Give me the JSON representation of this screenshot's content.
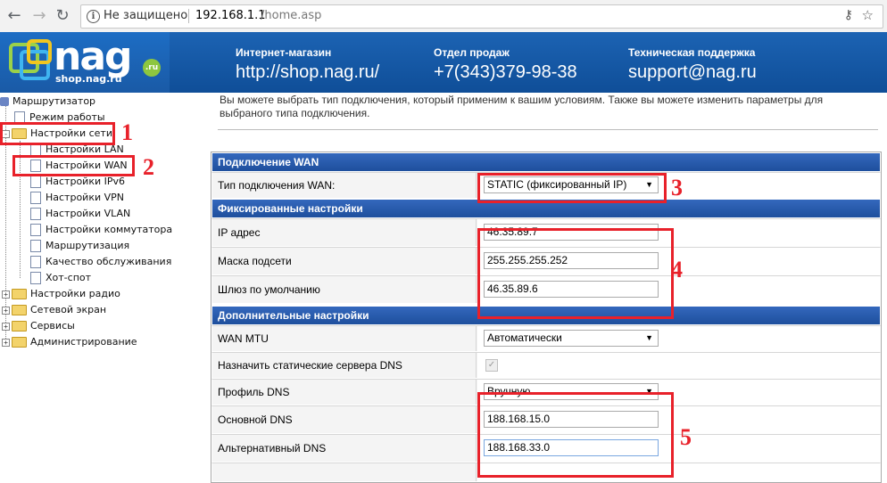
{
  "browser": {
    "back_icon": "arrow-left-icon",
    "forward_icon": "arrow-right-icon",
    "reload_icon": "reload-icon",
    "security_label": "Не защищено",
    "url_host": "192.168.1.1",
    "url_path": "/home.asp"
  },
  "banner": {
    "logo_text": "nag",
    "logo_badge": ".ru",
    "logo_site": "shop.nag.ru",
    "shop_label": "Интернет-магазин",
    "shop_value": "http://shop.nag.ru/",
    "sales_label": "Отдел продаж",
    "sales_value": "+7(343)379-98-38",
    "support_label": "Техническая поддержка",
    "support_value": "support@nag.ru"
  },
  "tree": {
    "root": "Маршрутизатор",
    "items": [
      {
        "label": "Режим работы"
      },
      {
        "label": "Настройки сети"
      },
      {
        "label": "Настройки LAN"
      },
      {
        "label": "Настройки WAN"
      },
      {
        "label": "Настройки IPv6"
      },
      {
        "label": "Настройки VPN"
      },
      {
        "label": "Настройки VLAN"
      },
      {
        "label": "Настройки коммутатора"
      },
      {
        "label": "Маршрутизация"
      },
      {
        "label": "Качество обслуживания"
      },
      {
        "label": "Хот-спот"
      },
      {
        "label": "Настройки радио"
      },
      {
        "label": "Сетевой экран"
      },
      {
        "label": "Сервисы"
      },
      {
        "label": "Администрирование"
      }
    ]
  },
  "annotations": [
    "1",
    "2",
    "3",
    "4",
    "5"
  ],
  "annotation_color": "#e8212a",
  "main": {
    "intro": "Вы можете выбрать тип подключения, который применим к вашим условиям. Также вы можете изменить параметры для выбраного типа подключения.",
    "sections": {
      "wan": {
        "title": "Подключение WAN",
        "type_label": "Тип подключения WAN:",
        "type_value": "STATIC (фиксированный IP)"
      },
      "fixed": {
        "title": "Фиксированные настройки",
        "ip_label": "IP адрес",
        "ip_value": "46.35.89.7",
        "mask_label": "Маска подсети",
        "mask_value": "255.255.255.252",
        "gw_label": "Шлюз по умолчанию",
        "gw_value": "46.35.89.6"
      },
      "extra": {
        "title": "Дополнительные настройки",
        "mtu_label": "WAN MTU",
        "mtu_value": "Автоматически",
        "static_dns_label": "Назначить статические сервера DNS",
        "dns_profile_label": "Профиль DNS",
        "dns_profile_value": "Вручную",
        "dns1_label": "Основной DNS",
        "dns1_value": "188.168.15.0",
        "dns2_label": "Альтернативный DNS",
        "dns2_value": "188.168.33.0"
      }
    }
  },
  "colors": {
    "section_header": "#1e4f9d",
    "banner": "#0f4e98"
  }
}
